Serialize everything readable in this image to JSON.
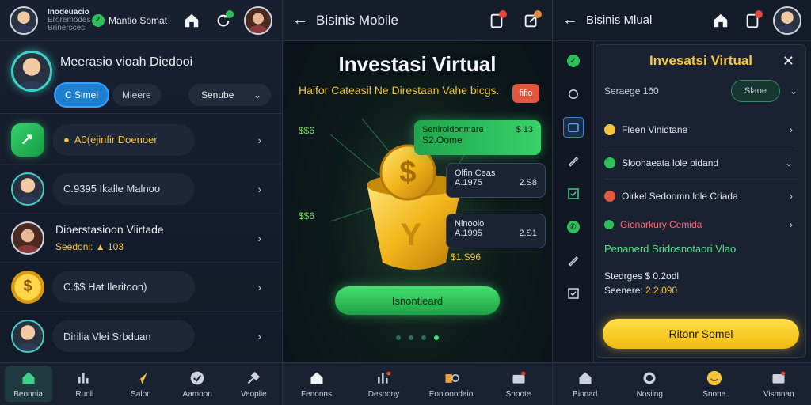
{
  "panel_left": {
    "brand": {
      "line1": "Inodeuacio",
      "line2": "Eroremodes",
      "line3": "Brinersces"
    },
    "app_name": "Mantio Somat",
    "profile": {
      "name": "Meerasio vioah Diedooi"
    },
    "segments": [
      "C Simel",
      "Mieere"
    ],
    "dropdown": "Senube",
    "rows": [
      {
        "accent": "●",
        "label": "A0(ejinfir Doenoer"
      },
      {
        "accent": "",
        "label": "C.9395 Ikalle Malnoo"
      },
      {
        "title": "Dioerstasioon Viirtade",
        "subtitle": "Seedoni: ▲ 103"
      },
      {
        "label": "C.$$ Hat Ileritoon)"
      },
      {
        "title": "Dirilia Vlei Srbduan"
      }
    ],
    "tabs": [
      "Beonnia",
      "Ruoli",
      "Salon",
      "Aamoon",
      "Veoplie"
    ]
  },
  "panel_center": {
    "back": "←",
    "title": "Bisinis Mobile",
    "hero_title": "Investasi Virtual",
    "hero_sub": "Haifor Cateasil Ne Direstaan Vahe bicgs.",
    "hero_badge": "fifio",
    "floating": [
      "$$6",
      "$$6"
    ],
    "card_green": {
      "line1": "Seniroldonmare",
      "line1_val": "$ 13",
      "line2": "S2.Oome"
    },
    "card_dark1": {
      "line1": "Olfin Ceas",
      "line2": "A.1975",
      "val": "2.S8"
    },
    "card_dark2": {
      "line1": "Ninoolo",
      "line2": "A.1995",
      "val": "2.S1"
    },
    "bag_value": "$1.S96",
    "cta": "Isnontleard",
    "tabs": [
      "Fenonns",
      "Desodny",
      "Eonioondaio",
      "Snoote"
    ]
  },
  "panel_right": {
    "title": "Bisinis Mlual",
    "sheet_title": "Invesatsi Virtual",
    "select_label": "Seraege 1ð0",
    "select_value": "Slaoe",
    "options": [
      {
        "label": "Fleen Vinidtane",
        "color": "#f2c43c"
      },
      {
        "label": "Sloohaeata lole bidand",
        "color": "#2fbf5a"
      },
      {
        "label": "Oirkel Sedoomn lole Criada",
        "color": "#e05a3b"
      }
    ],
    "detail_head": "Gionarkury Cemida",
    "detail_link": "Penanerd Sridosnotaori Vlao",
    "detail_kv1_label": "Stedrges $ 0.2odl",
    "detail_kv2_label": "Seenere:",
    "detail_kv2_value": "2.2.090",
    "cta": "Ritonr Somel",
    "tabs": [
      "Bionad",
      "Nosiing",
      "Snone",
      "Vismnan"
    ]
  },
  "colors": {
    "green": "#2fbf5a",
    "gold": "#f2c43c",
    "blue": "#1d7fd0",
    "red": "#e0483b"
  }
}
